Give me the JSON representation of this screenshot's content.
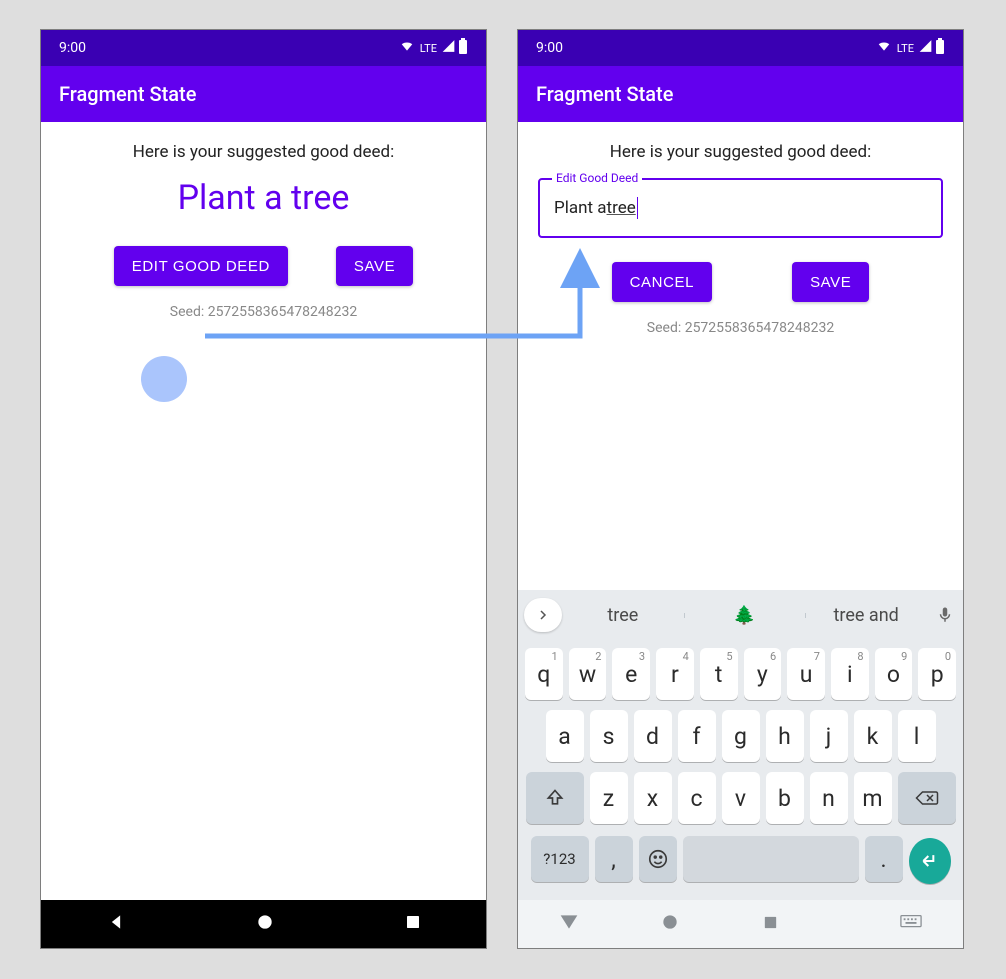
{
  "status": {
    "time": "9:00",
    "network": "LTE"
  },
  "appbar": {
    "title": "Fragment State"
  },
  "screen_left": {
    "prompt": "Here is your suggested good deed:",
    "deed": "Plant a tree",
    "buttons": {
      "edit": "EDIT GOOD DEED",
      "save": "SAVE"
    },
    "seed": "Seed: 2572558365478248232"
  },
  "screen_right": {
    "prompt": "Here is your suggested good deed:",
    "edit_label": "Edit Good Deed",
    "edit_value_prefix": "Plant a ",
    "edit_value_underlined": "tree",
    "buttons": {
      "cancel": "CANCEL",
      "save": "SAVE"
    },
    "seed": "Seed: 2572558365478248232"
  },
  "keyboard": {
    "suggestions": [
      "tree",
      "🌲",
      "tree and"
    ],
    "row1": [
      {
        "k": "q",
        "h": "1"
      },
      {
        "k": "w",
        "h": "2"
      },
      {
        "k": "e",
        "h": "3"
      },
      {
        "k": "r",
        "h": "4"
      },
      {
        "k": "t",
        "h": "5"
      },
      {
        "k": "y",
        "h": "6"
      },
      {
        "k": "u",
        "h": "7"
      },
      {
        "k": "i",
        "h": "8"
      },
      {
        "k": "o",
        "h": "9"
      },
      {
        "k": "p",
        "h": "0"
      }
    ],
    "row2": [
      "a",
      "s",
      "d",
      "f",
      "g",
      "h",
      "j",
      "k",
      "l"
    ],
    "row3": [
      "z",
      "x",
      "c",
      "v",
      "b",
      "n",
      "m"
    ],
    "sym_key": "?123",
    "comma": ",",
    "period": "."
  },
  "icons": {
    "wifi": "wifi-icon",
    "signal": "signal-icon",
    "battery": "battery-icon",
    "back": "back-icon",
    "home": "home-icon",
    "recent": "recent-icon",
    "kbd": "keyboard-icon",
    "shift": "shift-icon",
    "backspace": "backspace-icon",
    "emoji": "emoji-icon",
    "enter": "enter-icon",
    "mic": "mic-icon",
    "expand": "expand-icon"
  }
}
